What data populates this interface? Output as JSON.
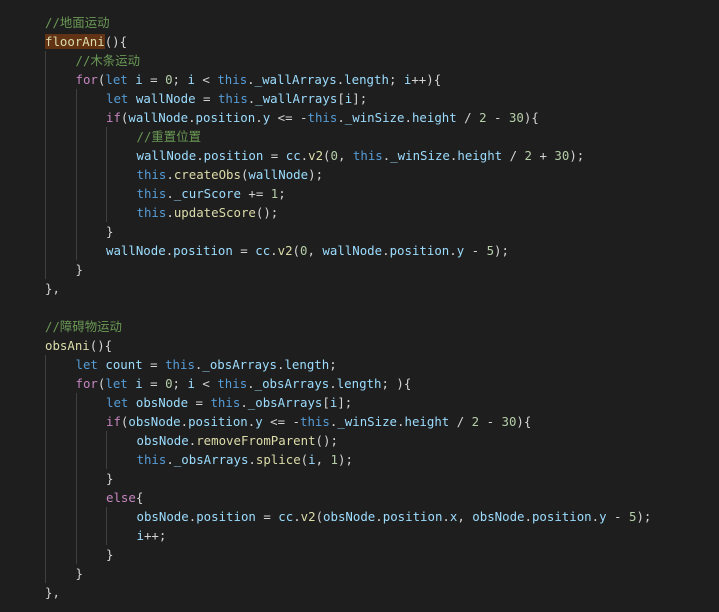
{
  "editor": {
    "theme": "dark",
    "colors": {
      "background": "#1e1e1e",
      "keyword": "#569cd6",
      "control": "#c586c0",
      "function": "#dcdcaa",
      "variable": "#9cdcfe",
      "number": "#b5cea8",
      "comment": "#6a9955",
      "text": "#d4d4d4",
      "highlight": "#613214"
    },
    "lines": [
      {
        "indent": 0,
        "tokens": [
          [
            "cmt",
            "//地面运动"
          ]
        ]
      },
      {
        "indent": 0,
        "tokens": [
          [
            "fn hl",
            "floorAni"
          ],
          [
            "pun",
            "(){"
          ]
        ]
      },
      {
        "indent": 1,
        "tokens": [
          [
            "cmt",
            "//木条运动"
          ]
        ]
      },
      {
        "indent": 1,
        "tokens": [
          [
            "ctl",
            "for"
          ],
          [
            "pun",
            "("
          ],
          [
            "kw",
            "let"
          ],
          [
            "pun",
            " "
          ],
          [
            "var",
            "i"
          ],
          [
            "pun",
            " = "
          ],
          [
            "num",
            "0"
          ],
          [
            "pun",
            "; "
          ],
          [
            "var",
            "i"
          ],
          [
            "pun",
            " < "
          ],
          [
            "kw",
            "this"
          ],
          [
            "pun",
            "."
          ],
          [
            "var",
            "_wallArrays"
          ],
          [
            "pun",
            "."
          ],
          [
            "var",
            "length"
          ],
          [
            "pun",
            "; "
          ],
          [
            "var",
            "i"
          ],
          [
            "pun",
            "++){"
          ]
        ]
      },
      {
        "indent": 2,
        "tokens": [
          [
            "kw",
            "let"
          ],
          [
            "pun",
            " "
          ],
          [
            "var",
            "wallNode"
          ],
          [
            "pun",
            " = "
          ],
          [
            "kw",
            "this"
          ],
          [
            "pun",
            "."
          ],
          [
            "var",
            "_wallArrays"
          ],
          [
            "pun",
            "["
          ],
          [
            "var",
            "i"
          ],
          [
            "pun",
            "];"
          ]
        ]
      },
      {
        "indent": 2,
        "tokens": [
          [
            "ctl",
            "if"
          ],
          [
            "pun",
            "("
          ],
          [
            "var",
            "wallNode"
          ],
          [
            "pun",
            "."
          ],
          [
            "var",
            "position"
          ],
          [
            "pun",
            "."
          ],
          [
            "var",
            "y"
          ],
          [
            "pun",
            " <= -"
          ],
          [
            "kw",
            "this"
          ],
          [
            "pun",
            "."
          ],
          [
            "var",
            "_winSize"
          ],
          [
            "pun",
            "."
          ],
          [
            "var",
            "height"
          ],
          [
            "pun",
            " / "
          ],
          [
            "num",
            "2"
          ],
          [
            "pun",
            " - "
          ],
          [
            "num",
            "30"
          ],
          [
            "pun",
            "){"
          ]
        ]
      },
      {
        "indent": 3,
        "tokens": [
          [
            "cmt",
            "//重置位置"
          ]
        ]
      },
      {
        "indent": 3,
        "tokens": [
          [
            "var",
            "wallNode"
          ],
          [
            "pun",
            "."
          ],
          [
            "var",
            "position"
          ],
          [
            "pun",
            " = "
          ],
          [
            "var",
            "cc"
          ],
          [
            "pun",
            "."
          ],
          [
            "fn",
            "v2"
          ],
          [
            "pun",
            "("
          ],
          [
            "num",
            "0"
          ],
          [
            "pun",
            ", "
          ],
          [
            "kw",
            "this"
          ],
          [
            "pun",
            "."
          ],
          [
            "var",
            "_winSize"
          ],
          [
            "pun",
            "."
          ],
          [
            "var",
            "height"
          ],
          [
            "pun",
            " / "
          ],
          [
            "num",
            "2"
          ],
          [
            "pun",
            " + "
          ],
          [
            "num",
            "30"
          ],
          [
            "pun",
            ");"
          ]
        ]
      },
      {
        "indent": 3,
        "tokens": [
          [
            "kw",
            "this"
          ],
          [
            "pun",
            "."
          ],
          [
            "fn",
            "createObs"
          ],
          [
            "pun",
            "("
          ],
          [
            "var",
            "wallNode"
          ],
          [
            "pun",
            ");"
          ]
        ]
      },
      {
        "indent": 3,
        "tokens": [
          [
            "kw",
            "this"
          ],
          [
            "pun",
            "."
          ],
          [
            "var",
            "_curScore"
          ],
          [
            "pun",
            " += "
          ],
          [
            "num",
            "1"
          ],
          [
            "pun",
            ";"
          ]
        ]
      },
      {
        "indent": 3,
        "tokens": [
          [
            "kw",
            "this"
          ],
          [
            "pun",
            "."
          ],
          [
            "fn",
            "updateScore"
          ],
          [
            "pun",
            "();"
          ]
        ]
      },
      {
        "indent": 2,
        "tokens": [
          [
            "pun",
            "}"
          ]
        ]
      },
      {
        "indent": 2,
        "tokens": [
          [
            "var",
            "wallNode"
          ],
          [
            "pun",
            "."
          ],
          [
            "var",
            "position"
          ],
          [
            "pun",
            " = "
          ],
          [
            "var",
            "cc"
          ],
          [
            "pun",
            "."
          ],
          [
            "fn",
            "v2"
          ],
          [
            "pun",
            "("
          ],
          [
            "num",
            "0"
          ],
          [
            "pun",
            ", "
          ],
          [
            "var",
            "wallNode"
          ],
          [
            "pun",
            "."
          ],
          [
            "var",
            "position"
          ],
          [
            "pun",
            "."
          ],
          [
            "var",
            "y"
          ],
          [
            "pun",
            " - "
          ],
          [
            "num",
            "5"
          ],
          [
            "pun",
            ");"
          ]
        ]
      },
      {
        "indent": 1,
        "tokens": [
          [
            "pun",
            "}"
          ]
        ]
      },
      {
        "indent": 0,
        "tokens": [
          [
            "pun",
            "},"
          ]
        ]
      },
      {
        "indent": 0,
        "tokens": []
      },
      {
        "indent": 0,
        "tokens": [
          [
            "cmt",
            "//障碍物运动"
          ]
        ]
      },
      {
        "indent": 0,
        "tokens": [
          [
            "fn",
            "obsAni"
          ],
          [
            "pun",
            "(){"
          ]
        ]
      },
      {
        "indent": 1,
        "tokens": [
          [
            "kw",
            "let"
          ],
          [
            "pun",
            " "
          ],
          [
            "var",
            "count"
          ],
          [
            "pun",
            " = "
          ],
          [
            "kw",
            "this"
          ],
          [
            "pun",
            "."
          ],
          [
            "var",
            "_obsArrays"
          ],
          [
            "pun",
            "."
          ],
          [
            "var",
            "length"
          ],
          [
            "pun",
            ";"
          ]
        ]
      },
      {
        "indent": 1,
        "tokens": [
          [
            "ctl",
            "for"
          ],
          [
            "pun",
            "("
          ],
          [
            "kw",
            "let"
          ],
          [
            "pun",
            " "
          ],
          [
            "var",
            "i"
          ],
          [
            "pun",
            " = "
          ],
          [
            "num",
            "0"
          ],
          [
            "pun",
            "; "
          ],
          [
            "var",
            "i"
          ],
          [
            "pun",
            " < "
          ],
          [
            "kw",
            "this"
          ],
          [
            "pun",
            "."
          ],
          [
            "var",
            "_obsArrays"
          ],
          [
            "pun",
            "."
          ],
          [
            "var",
            "length"
          ],
          [
            "pun",
            "; ){"
          ]
        ]
      },
      {
        "indent": 2,
        "tokens": [
          [
            "kw",
            "let"
          ],
          [
            "pun",
            " "
          ],
          [
            "var",
            "obsNode"
          ],
          [
            "pun",
            " = "
          ],
          [
            "kw",
            "this"
          ],
          [
            "pun",
            "."
          ],
          [
            "var",
            "_obsArrays"
          ],
          [
            "pun",
            "["
          ],
          [
            "var",
            "i"
          ],
          [
            "pun",
            "];"
          ]
        ]
      },
      {
        "indent": 2,
        "tokens": [
          [
            "ctl",
            "if"
          ],
          [
            "pun",
            "("
          ],
          [
            "var",
            "obsNode"
          ],
          [
            "pun",
            "."
          ],
          [
            "var",
            "position"
          ],
          [
            "pun",
            "."
          ],
          [
            "var",
            "y"
          ],
          [
            "pun",
            " <= -"
          ],
          [
            "kw",
            "this"
          ],
          [
            "pun",
            "."
          ],
          [
            "var",
            "_winSize"
          ],
          [
            "pun",
            "."
          ],
          [
            "var",
            "height"
          ],
          [
            "pun",
            " / "
          ],
          [
            "num",
            "2"
          ],
          [
            "pun",
            " - "
          ],
          [
            "num",
            "30"
          ],
          [
            "pun",
            "){"
          ]
        ]
      },
      {
        "indent": 3,
        "tokens": [
          [
            "var",
            "obsNode"
          ],
          [
            "pun",
            "."
          ],
          [
            "fn",
            "removeFromParent"
          ],
          [
            "pun",
            "();"
          ]
        ]
      },
      {
        "indent": 3,
        "tokens": [
          [
            "kw",
            "this"
          ],
          [
            "pun",
            "."
          ],
          [
            "var",
            "_obsArrays"
          ],
          [
            "pun",
            "."
          ],
          [
            "fn",
            "splice"
          ],
          [
            "pun",
            "("
          ],
          [
            "var",
            "i"
          ],
          [
            "pun",
            ", "
          ],
          [
            "num",
            "1"
          ],
          [
            "pun",
            ");"
          ]
        ]
      },
      {
        "indent": 2,
        "tokens": [
          [
            "pun",
            "}"
          ]
        ]
      },
      {
        "indent": 2,
        "tokens": [
          [
            "ctl",
            "else"
          ],
          [
            "pun",
            "{"
          ]
        ]
      },
      {
        "indent": 3,
        "tokens": [
          [
            "var",
            "obsNode"
          ],
          [
            "pun",
            "."
          ],
          [
            "var",
            "position"
          ],
          [
            "pun",
            " = "
          ],
          [
            "var",
            "cc"
          ],
          [
            "pun",
            "."
          ],
          [
            "fn",
            "v2"
          ],
          [
            "pun",
            "("
          ],
          [
            "var",
            "obsNode"
          ],
          [
            "pun",
            "."
          ],
          [
            "var",
            "position"
          ],
          [
            "pun",
            "."
          ],
          [
            "var",
            "x"
          ],
          [
            "pun",
            ", "
          ],
          [
            "var",
            "obsNode"
          ],
          [
            "pun",
            "."
          ],
          [
            "var",
            "position"
          ],
          [
            "pun",
            "."
          ],
          [
            "var",
            "y"
          ],
          [
            "pun",
            " - "
          ],
          [
            "num",
            "5"
          ],
          [
            "pun",
            ");"
          ]
        ]
      },
      {
        "indent": 3,
        "tokens": [
          [
            "var",
            "i"
          ],
          [
            "pun",
            "++;"
          ]
        ]
      },
      {
        "indent": 2,
        "tokens": [
          [
            "pun",
            "}"
          ]
        ]
      },
      {
        "indent": 1,
        "tokens": [
          [
            "pun",
            "}"
          ]
        ]
      },
      {
        "indent": 0,
        "tokens": [
          [
            "pun",
            "},"
          ]
        ]
      }
    ]
  }
}
